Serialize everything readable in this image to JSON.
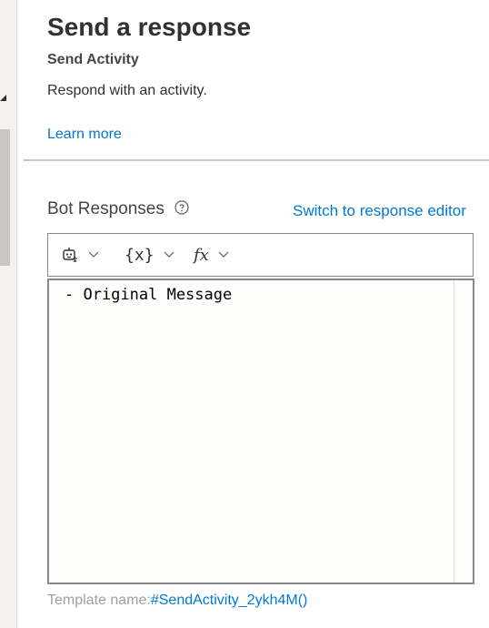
{
  "panel": {
    "title": "Send a response",
    "subtitle": "Send Activity",
    "description": "Respond with an activity.",
    "learn_more": "Learn more"
  },
  "responses": {
    "label": "Bot Responses",
    "switch_link": "Switch to response editor",
    "toolbar": {
      "items": [
        {
          "icon": "bot-icon"
        },
        {
          "label": "{x}"
        },
        {
          "label": "fx"
        }
      ]
    },
    "editor_text": "- Original Message",
    "template_label": "Template name:",
    "template_value": "#SendActivity_2ykh4M()"
  },
  "colors": {
    "link": "#0078d4",
    "text": "#323130",
    "border": "#8a8886"
  }
}
